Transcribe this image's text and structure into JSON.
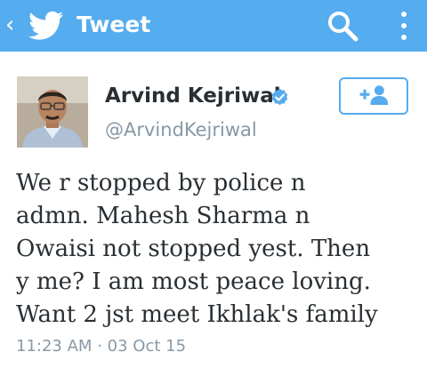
{
  "header": {
    "back_glyph": "‹",
    "back_icon": "chevron-left-icon",
    "logo_icon": "twitter-bird-icon",
    "title": "Tweet",
    "search_icon": "search-icon",
    "more_icon": "overflow-menu-icon",
    "bar_color": "#55acee"
  },
  "tweet": {
    "author_name": "Arvind Kejriwal",
    "handle": "@ArvindKejriwal",
    "verified_icon": "verified-badge-icon",
    "follow_icon": "follow-user-icon",
    "text_lines": [
      "We r stopped by police n",
      "admn. Mahesh Sharma n",
      "Owaisi not stopped yest. Then",
      "y me? I am most peace loving.",
      "Want 2 jst meet Ikhlak's family"
    ],
    "time": "11:23 AM",
    "separator": "·",
    "date": "03 Oct 15"
  },
  "colors": {
    "accent": "#55acee",
    "text": "#292f33",
    "muted": "#8899a6"
  }
}
